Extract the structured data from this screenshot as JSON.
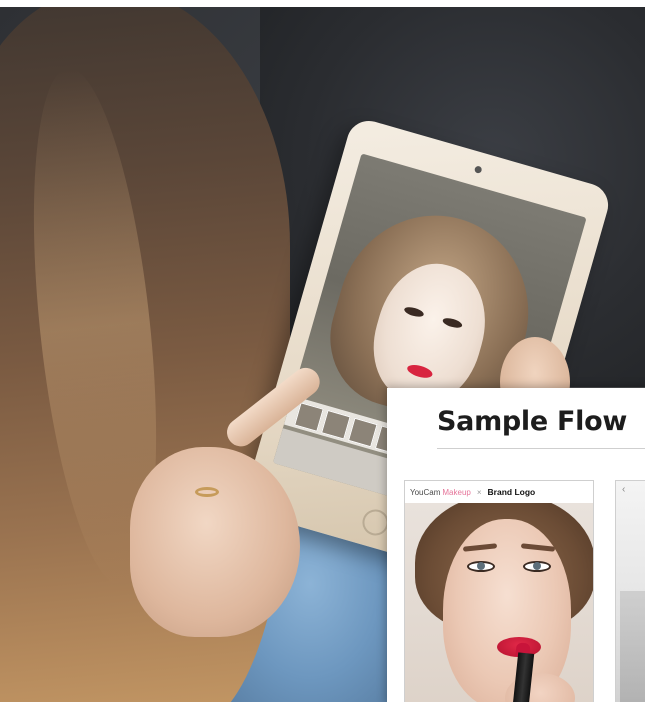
{
  "flow_card": {
    "title": "Sample Flow",
    "screen1": {
      "brand_youcam": "YouCam",
      "brand_makeup": "Makeup",
      "brand_separator": "×",
      "brand_logo": "Brand Logo"
    },
    "screen2": {
      "back_icon": "chevron-left-icon"
    }
  },
  "colors": {
    "makeup_accent": "#e6759a",
    "lipstick_red": "#d8243f"
  }
}
